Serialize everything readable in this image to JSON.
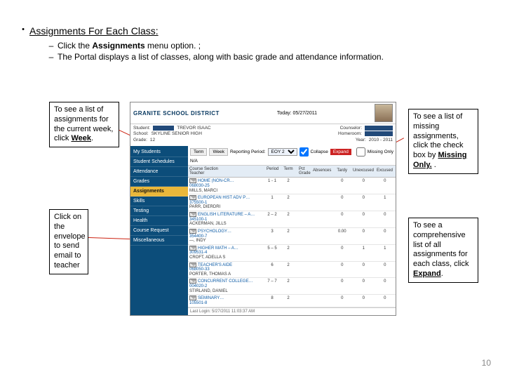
{
  "heading": "Assignments For Each Class:",
  "sub1_pre": "Click the ",
  "sub1_bold": "Assignments",
  "sub1_post": " menu option. ;",
  "sub2": "The Portal displays a list of classes, along with basic grade and attendance information.",
  "callout1_a": "To see a list of assignments for the current week, click ",
  "callout1_b": "Week",
  "callout1_c": ".",
  "callout2_a": "To see a list of missing assignments, click the check box by ",
  "callout2_b": "Missing Only.",
  "callout2_c": " .",
  "callout3": "Click on the envelope to send email to teacher",
  "callout4_a": "To see a comprehensive list of all assignments for each class, click ",
  "callout4_b": "Expand",
  "callout4_c": ".",
  "portal": {
    "brand": "GRANITE SCHOOL DISTRICT",
    "date": "Today: 05/27/2011",
    "student_label": "Student:",
    "student": "TREVOR ISAAC",
    "counselor_label": "Counselor:",
    "school_label": "School:",
    "school": "SKYLINE SENIOR HIGH",
    "homeroom_label": "Homeroom:",
    "grade_label": "Grade:",
    "grade": "12",
    "year_label": "Year:",
    "year": "2010 - 2011",
    "sidebar": {
      "s0": "My Students",
      "s1": "Student Schedules",
      "s2": "Attendance",
      "s3": "Grades",
      "s4": "Assignments",
      "s5": "Skills",
      "s6": "Testing",
      "s7": "Health",
      "s8": "Course Request",
      "s9": "Miscellaneous"
    },
    "toolbar": {
      "term": "Term",
      "week": "Week",
      "rp_label": "Reporting Period:",
      "rp": "EOY 2",
      "collapse": "Collapse",
      "expand": "Expand",
      "missing": "Missing Only",
      "na": "N/A"
    },
    "thead": {
      "course": "Course Section",
      "teacher": "Teacher",
      "period": "Period",
      "term": "Term",
      "grade": "Pct Grade",
      "absences": "Absences",
      "tardy": "Tardy",
      "unex": "Unexcused",
      "exc": "Excused"
    },
    "rows": [
      {
        "course": "HOME (NON-CR…",
        "code": "068030-25",
        "teacher": "MILLS, MARCI",
        "period": "1 - 1",
        "term": "2",
        "t": "0",
        "u": "0",
        "e": "0"
      },
      {
        "course": "EUROPEAN HIST ADV P…",
        "code": "375500-1",
        "teacher": "PARR, DIERDRI",
        "period": "1",
        "term": "2",
        "t": "0",
        "u": "0",
        "e": "1"
      },
      {
        "course": "ENGLISH LITERATURE – A…",
        "code": "345100-1",
        "teacher": "ACKERMAN, JILLS",
        "period": "2 – 2",
        "term": "2",
        "t": "0",
        "u": "0",
        "e": "0"
      },
      {
        "course": "PSYCHOLOGY…",
        "code": "354400-7",
        "teacher": "—, INDY",
        "period": "3",
        "term": "2",
        "t": "0.00",
        "u": "0",
        "e": "0"
      },
      {
        "course": "HIGHER MATH – A…",
        "code": "309531-4",
        "teacher": "CROFT, ADELLA S",
        "period": "5 – 5",
        "term": "2",
        "t": "0",
        "u": "1",
        "e": "1"
      },
      {
        "course": "TEACHER'S AIDE",
        "code": "068050-33",
        "teacher": "PORTER, THOMAS A",
        "period": "6",
        "term": "2",
        "t": "0",
        "u": "0",
        "e": "0"
      },
      {
        "course": "CONCURRENT COLLEGE…",
        "code": "004020-2",
        "teacher": "STIRLAND, DANIEL",
        "period": "7 – 7",
        "term": "2",
        "t": "0",
        "u": "0",
        "e": "0"
      },
      {
        "course": "SEMINARY…",
        "code": "105501-8",
        "teacher": "",
        "period": "8",
        "term": "2",
        "t": "0",
        "u": "0",
        "e": "0"
      }
    ],
    "lastlogin": "Last Login: 5/27/2011 11:03:37 AM"
  },
  "page_num": "10"
}
